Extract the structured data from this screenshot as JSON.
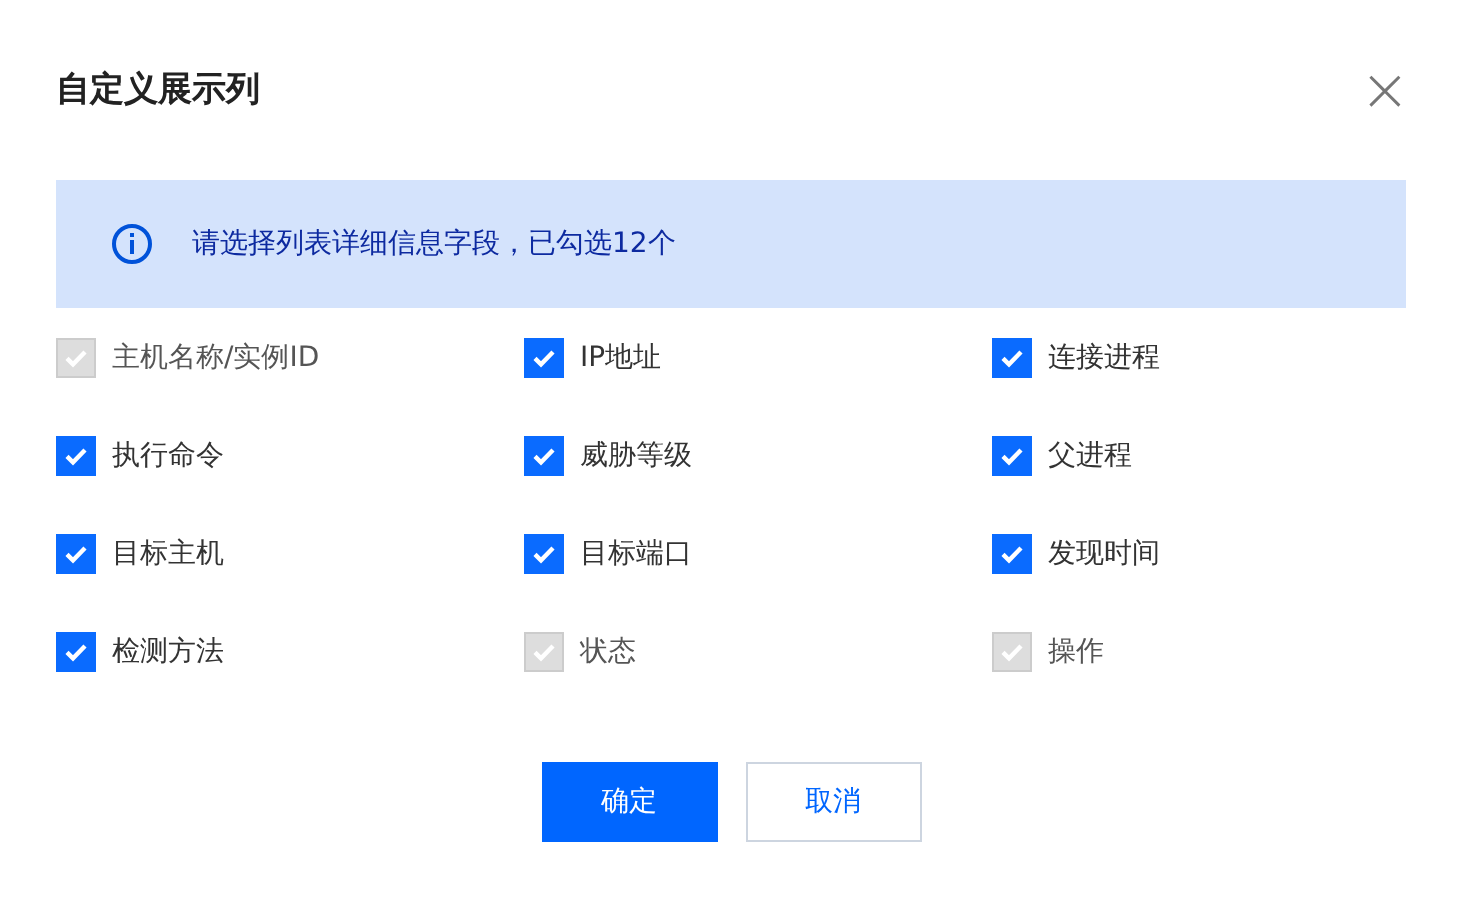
{
  "dialog": {
    "title": "自定义展示列",
    "close": "×"
  },
  "notice": {
    "text": "请选择列表详细信息字段，已勾选12个"
  },
  "columns": [
    {
      "label": "主机名称/实例ID",
      "checked": true,
      "disabled": true
    },
    {
      "label": "IP地址",
      "checked": true,
      "disabled": false
    },
    {
      "label": "连接进程",
      "checked": true,
      "disabled": false
    },
    {
      "label": "执行命令",
      "checked": true,
      "disabled": false
    },
    {
      "label": "威胁等级",
      "checked": true,
      "disabled": false
    },
    {
      "label": "父进程",
      "checked": true,
      "disabled": false
    },
    {
      "label": "目标主机",
      "checked": true,
      "disabled": false
    },
    {
      "label": "目标端口",
      "checked": true,
      "disabled": false
    },
    {
      "label": "发现时间",
      "checked": true,
      "disabled": false
    },
    {
      "label": "检测方法",
      "checked": true,
      "disabled": false
    },
    {
      "label": "状态",
      "checked": true,
      "disabled": true
    },
    {
      "label": "操作",
      "checked": true,
      "disabled": true
    }
  ],
  "buttons": [
    {
      "label": "确定",
      "kind": "primary"
    },
    {
      "label": "取消",
      "kind": "secondary"
    }
  ]
}
